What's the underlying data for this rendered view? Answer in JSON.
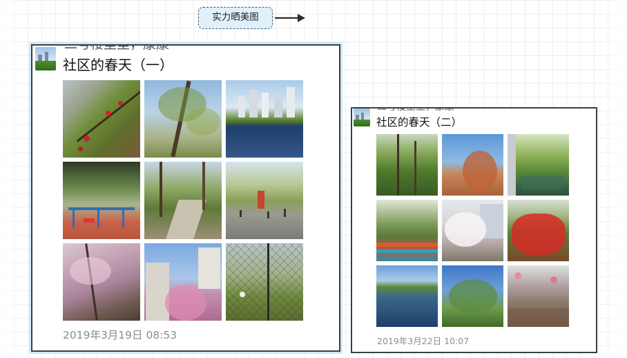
{
  "note": {
    "label": "实力晒美图",
    "color": "#dff0fa",
    "border_color": "#3a5f7a",
    "icon": "right-arrow-icon"
  },
  "posts": [
    {
      "author_partial": "二号楼里里，康康",
      "title": "社区的春天（一）",
      "timestamp": "2019年3月19日 08:53",
      "photos": [
        {
          "alt": "red-flowers-on-lawn"
        },
        {
          "alt": "budding-tree-blue-sky"
        },
        {
          "alt": "city-skyline-lake-reflection"
        },
        {
          "alt": "playground-fitness-equipment"
        },
        {
          "alt": "park-walkway-willows"
        },
        {
          "alt": "plaza-with-people-exercising"
        },
        {
          "alt": "pink-blossom-branches"
        },
        {
          "alt": "pink-tree-and-building"
        },
        {
          "alt": "blossom-behind-fence"
        }
      ]
    },
    {
      "author_partial": "二号楼里里，康康",
      "title": "社区的春天（二）",
      "timestamp": "2019年3月22日 10:07",
      "photos": [
        {
          "alt": "green-willow-grove"
        },
        {
          "alt": "orange-leaves-blue-sky"
        },
        {
          "alt": "canal-with-willows"
        },
        {
          "alt": "running-track-trees"
        },
        {
          "alt": "white-blossom-building"
        },
        {
          "alt": "red-flowering-shrub"
        },
        {
          "alt": "pond-reflection"
        },
        {
          "alt": "palm-tree-from-below"
        },
        {
          "alt": "garden-path-pink-blossom"
        }
      ]
    }
  ]
}
